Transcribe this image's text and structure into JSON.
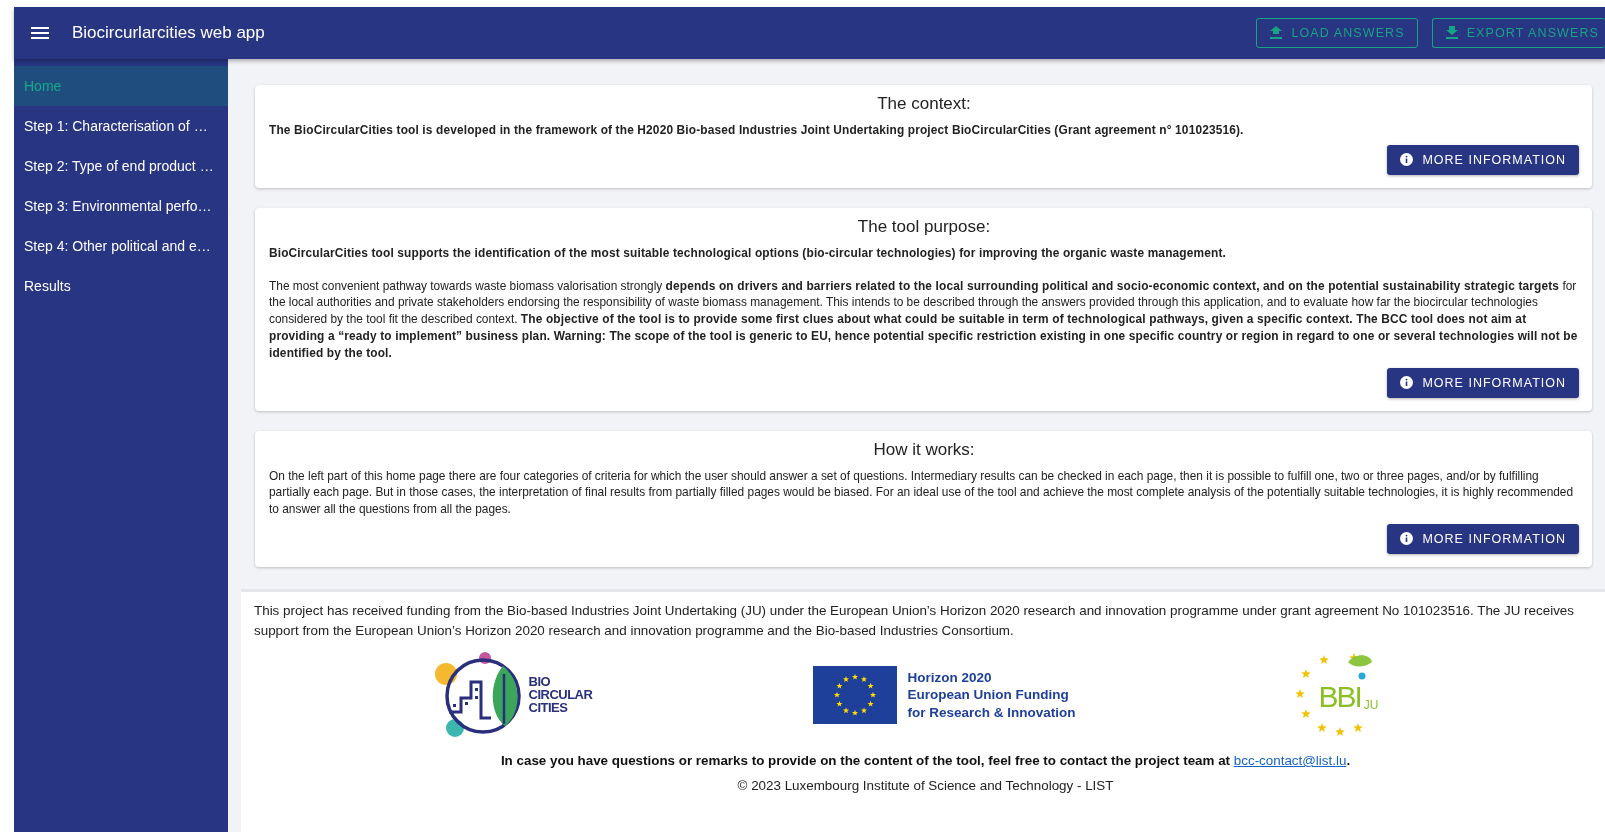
{
  "app_bar": {
    "title": "Biocircurlarcities web app",
    "buttons": [
      {
        "label": "LOAD ANSWERS",
        "kind": "upload"
      },
      {
        "label": "EXPORT ANSWERS",
        "kind": "download"
      }
    ]
  },
  "sidebar": {
    "items": [
      {
        "label": "Home",
        "selected": true
      },
      {
        "label": "Step 1: Characterisation of …",
        "selected": false
      },
      {
        "label": "Step 2: Type of end product …",
        "selected": false
      },
      {
        "label": "Step 3: Environmental perfo…",
        "selected": false
      },
      {
        "label": "Step 4: Other political and e…",
        "selected": false
      },
      {
        "label": "Results",
        "selected": false
      }
    ]
  },
  "cards": [
    {
      "title": "The context:",
      "paragraphs": [
        {
          "text": "The BioCircularCities tool is developed in the framework of the H2020 Bio-based Industries Joint Undertaking project BioCircularCities (Grant agreement n° 101023516).",
          "emphasis": true
        }
      ],
      "button": "MORE INFORMATION"
    },
    {
      "title": "The tool purpose:",
      "paragraphs": [
        {
          "text": "BioCircularCities tool supports the identification of the most suitable technological options (bio-circular technologies) for improving the organic waste management.",
          "emphasis": true
        },
        {
          "text": "The most convenient pathway towards waste biomass valorisation strongly **depends on drivers and barriers related to the local surrounding political and socio-economic context, and on the potential sustainability strategic targets** for the local authorities and private stakeholders endorsing the responsibility of waste biomass management. This intends to be described through the answers provided through this application, and to evaluate how far the biocircular technologies considered by the tool fit the described context. **The objective of the tool is to provide some first clues about what could be suitable in term of technological pathways, given a specific context. The BCC tool does not aim at providing a “ready to implement” business plan. Warning: The scope of the tool is generic to EU, hence potential specific restriction existing in one specific country or region in regard to one or several technologies will not be identified by the tool.**",
          "emphasis": false
        }
      ],
      "button": "MORE INFORMATION"
    },
    {
      "title": "How it works:",
      "paragraphs": [
        {
          "text": "On the left part of this home page there are four categories of criteria for which the user should answer a set of questions. Intermediary results can be checked in each page, then it is possible to fulfill one, two or three pages, and/or by fulfilling partially each page. But in those cases, the interpretation of final results from partially filled pages would be biased. For an ideal use of the tool and achieve the most complete analysis of the potentially suitable technologies, it is highly recommended to answer all the questions from all the pages.",
          "emphasis": false
        }
      ],
      "button": "MORE INFORMATION"
    }
  ],
  "footer": {
    "funding_text": "This project has received funding from the Bio-based Industries Joint Undertaking (JU) under the European Union’s Horizon 2020 research and innovation programme under grant agreement No 101023516. The JU receives support from the European Union’s Horizon 2020 research and innovation programme and the Bio-based Industries Consortium.",
    "logos": [
      {
        "kind": "bcc",
        "lines": [
          "BIO",
          "CIRCULAR",
          "CITIES"
        ]
      },
      {
        "kind": "eu",
        "lines": [
          "Horizon 2020",
          "European Union Funding",
          "for Research & Innovation"
        ]
      },
      {
        "kind": "bbi",
        "lines": [
          "BBI",
          "JU"
        ]
      }
    ],
    "contact": {
      "text": "In case you have questions or remarks to provide on the content of the tool, feel free to contact the project team at ",
      "link": "bcc-contact@list.lu",
      "end": "."
    },
    "copyright": "© 2023 Luxembourg Institute of Science and Technology - LIST"
  }
}
